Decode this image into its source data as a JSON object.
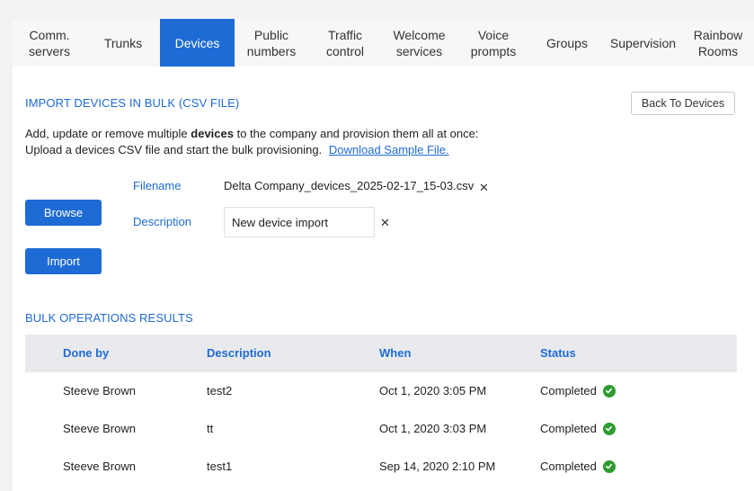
{
  "tabs": [
    {
      "label": "Comm.\nservers",
      "width": 82
    },
    {
      "label": "Trunks",
      "width": 82
    },
    {
      "label": "Devices",
      "width": 82
    },
    {
      "label": "Public\nnumbers",
      "width": 82
    },
    {
      "label": "Traffic\ncontrol",
      "width": 82
    },
    {
      "label": "Welcome\nservices",
      "width": 82
    },
    {
      "label": "Voice\nprompts",
      "width": 82
    },
    {
      "label": "Groups",
      "width": 82
    },
    {
      "label": "Supervision",
      "width": 86
    },
    {
      "label": "Rainbow\nRooms",
      "width": 73
    }
  ],
  "active_tab": "Devices",
  "import": {
    "title": "IMPORT DEVICES IN BULK (CSV FILE)",
    "back_button": "Back To Devices",
    "intro_line1_before": "Add, update or remove multiple ",
    "intro_line1_bold": "devices",
    "intro_line1_after": " to the company and provision them all at once:",
    "intro_line2": "Upload a devices CSV file and start the bulk provisioning.",
    "sample_link": "Download Sample File.",
    "browse_button": "Browse",
    "import_button": "Import",
    "filename_label": "Filename",
    "filename_value": "Delta Company_devices_2025-02-17_15-03.csv",
    "description_label": "Description",
    "description_value": "New device import",
    "remove_glyph": "✕"
  },
  "results": {
    "title": "BULK OPERATIONS RESULTS",
    "columns": [
      "Done by",
      "Description",
      "When",
      "Status"
    ],
    "rows": [
      {
        "done_by": "Steeve Brown",
        "description": "test2",
        "when": "Oct 1, 2020 3:05 PM",
        "status": "Completed"
      },
      {
        "done_by": "Steeve Brown",
        "description": "tt",
        "when": "Oct 1, 2020 3:03 PM",
        "status": "Completed"
      },
      {
        "done_by": "Steeve Brown",
        "description": "test1",
        "when": "Sep 14, 2020 2:10 PM",
        "status": "Completed"
      }
    ],
    "status_color": "#2e9b2e"
  },
  "colors": {
    "accent": "#1f6bd6"
  }
}
